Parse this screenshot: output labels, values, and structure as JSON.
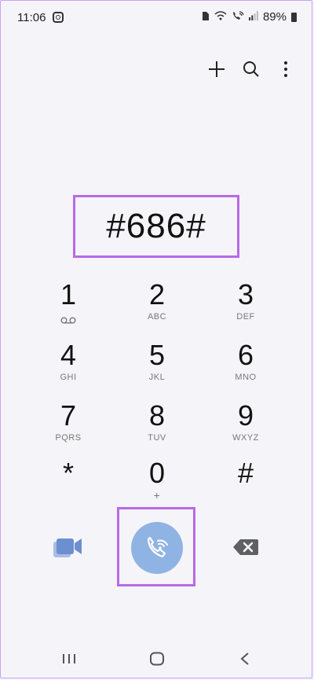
{
  "status_bar": {
    "time": "11:06",
    "battery": "89%"
  },
  "display": {
    "number": "#686#"
  },
  "keypad": [
    {
      "digit": "1",
      "letters": ""
    },
    {
      "digit": "2",
      "letters": "ABC"
    },
    {
      "digit": "3",
      "letters": "DEF"
    },
    {
      "digit": "4",
      "letters": "GHI"
    },
    {
      "digit": "5",
      "letters": "JKL"
    },
    {
      "digit": "6",
      "letters": "MNO"
    },
    {
      "digit": "7",
      "letters": "PQRS"
    },
    {
      "digit": "8",
      "letters": "TUV"
    },
    {
      "digit": "9",
      "letters": "WXYZ"
    },
    {
      "digit": "*",
      "letters": ""
    },
    {
      "digit": "0",
      "letters": "+"
    },
    {
      "digit": "#",
      "letters": ""
    }
  ],
  "colors": {
    "accent_call": "#8fb3e3",
    "video_icon": "#6b8fd0",
    "highlight_border": "#b76ae6",
    "background": "#f5f4f9"
  },
  "icons": [
    "instagram-icon",
    "sim-icon",
    "wifi-icon",
    "wifi-calling-icon",
    "signal-icon",
    "battery-icon",
    "add-icon",
    "search-icon",
    "more-icon",
    "voicemail-icon",
    "video-call-icon",
    "wifi-call-icon",
    "backspace-icon",
    "recent-apps-icon",
    "home-icon",
    "back-icon"
  ]
}
